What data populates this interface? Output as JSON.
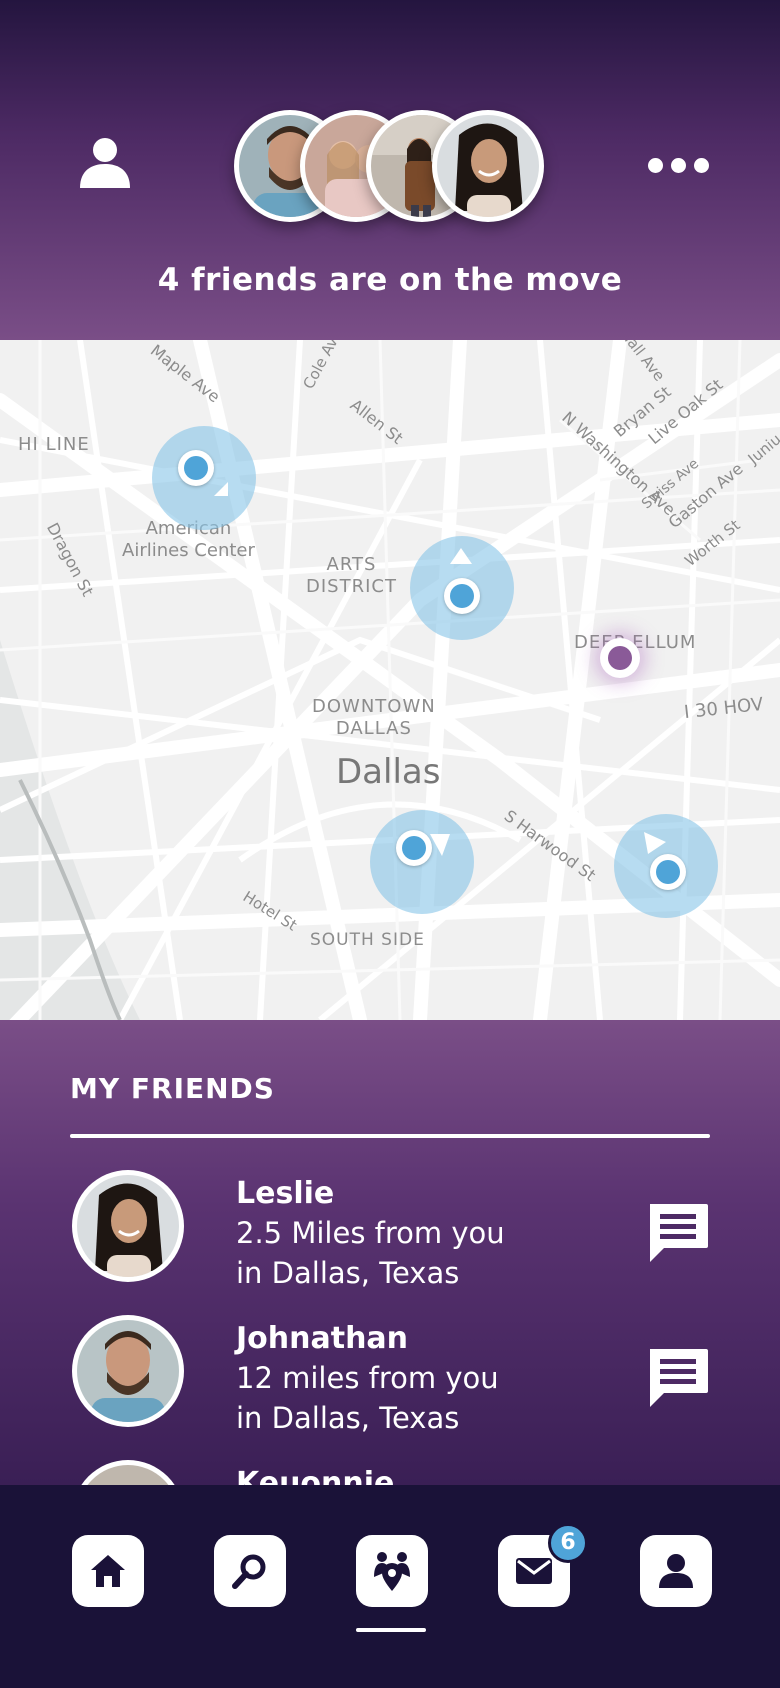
{
  "header": {
    "caption": "4 friends are on the move",
    "avatars": [
      "Johnathan",
      "Friends group",
      "Keuonnie",
      "Leslie"
    ]
  },
  "map": {
    "labels": {
      "hi_line": "HI LINE",
      "american_airlines_center": "American\nAirlines Center",
      "arts_district": "ARTS\nDISTRICT",
      "deep_ellum": "DEEP ELLUM",
      "downtown_dallas": "DOWNTOWN\nDALLAS",
      "dallas": "Dallas",
      "south_side": "SOUTH SIDE",
      "i30_hov": "I 30 HOV",
      "maple_ave": "Maple Ave",
      "cole_ave": "Cole Ave",
      "allen_st": "Allen St",
      "n_washington_ave": "N Washington Ave",
      "bryan_st": "Bryan St",
      "live_oak_st": "Live Oak St",
      "swiss_ave": "Swiss Ave",
      "gaston_ave": "Gaston Ave",
      "worth_st": "Worth St",
      "dragon_st": "Dragon St",
      "hotel_st": "Hotel St",
      "s_harwood_st": "S Harwood St",
      "hall_ave": "Hall Ave",
      "junius": "Juniu"
    },
    "colors": {
      "friend_pin": "#4fa4d8",
      "self_pin": "#8a5a98"
    }
  },
  "friends": {
    "title": "MY FRIENDS",
    "list": [
      {
        "name": "Leslie",
        "distance": "2.5 Miles from you",
        "location": "in Dallas, Texas"
      },
      {
        "name": "Johnathan",
        "distance": "12 miles from you",
        "location": "in Dallas, Texas"
      },
      {
        "name": "Keuonnie",
        "distance": "",
        "location": ""
      }
    ]
  },
  "tabbar": {
    "items": [
      "home-icon",
      "search-icon",
      "friends-map-icon",
      "mail-icon",
      "profile-icon"
    ],
    "mail_badge": "6",
    "active": "friends-map-icon"
  }
}
